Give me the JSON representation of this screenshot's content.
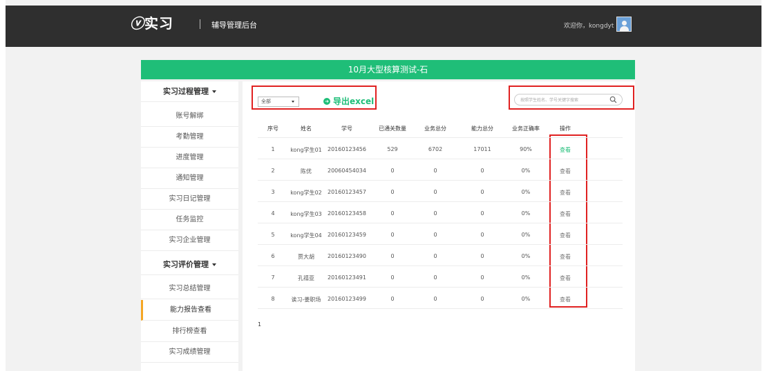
{
  "header": {
    "logo_mark": "ⓥ",
    "logo_text": "实习",
    "app_title": "辅导管理后台",
    "welcome": "欢迎你，kongdyt"
  },
  "exam_title": "10月大型核算测试-石",
  "sidebar": {
    "items": [
      {
        "label": "实习过程管理",
        "type": "header"
      },
      {
        "label": "账号解绑"
      },
      {
        "label": "考勤管理"
      },
      {
        "label": "进度管理"
      },
      {
        "label": "通知管理"
      },
      {
        "label": "实习日记管理"
      },
      {
        "label": "任务监控"
      },
      {
        "label": "实习企业管理"
      },
      {
        "label": "实习评价管理",
        "type": "header"
      },
      {
        "label": "实习总结管理"
      },
      {
        "label": "能力报告查看",
        "active": true
      },
      {
        "label": "排行榜查看"
      },
      {
        "label": "实习成绩管理"
      }
    ]
  },
  "toolbar": {
    "filter_value": "全部",
    "export_label": "导出excel",
    "search_placeholder": "按照学生姓名、学号关键字搜索"
  },
  "table": {
    "headers": [
      "序号",
      "姓名",
      "学号",
      "已通关数量",
      "业务总分",
      "能力总分",
      "业务正确率",
      "操作"
    ],
    "rows": [
      [
        "1",
        "kong学生01",
        "20160123456",
        "529",
        "6702",
        "17011",
        "90%",
        "查看"
      ],
      [
        "2",
        "陈优",
        "20060454034",
        "0",
        "0",
        "0",
        "0%",
        "查看"
      ],
      [
        "3",
        "kong学生02",
        "20160123457",
        "0",
        "0",
        "0",
        "0%",
        "查看"
      ],
      [
        "4",
        "kong学生03",
        "20160123458",
        "0",
        "0",
        "0",
        "0%",
        "查看"
      ],
      [
        "5",
        "kong学生04",
        "20160123459",
        "0",
        "0",
        "0",
        "0%",
        "查看"
      ],
      [
        "6",
        "贾大胡",
        "20160123490",
        "0",
        "0",
        "0",
        "0%",
        "查看"
      ],
      [
        "7",
        "孔禧亚",
        "20160123491",
        "0",
        "0",
        "0",
        "0%",
        "查看"
      ],
      [
        "8",
        "诶习-姜职场",
        "20160123499",
        "0",
        "0",
        "0",
        "0%",
        "查看"
      ]
    ]
  },
  "pagination": {
    "current": "1"
  },
  "colors": {
    "accent": "#1fbe78",
    "highlight": "#e02020",
    "active_marker": "#f5a623"
  }
}
